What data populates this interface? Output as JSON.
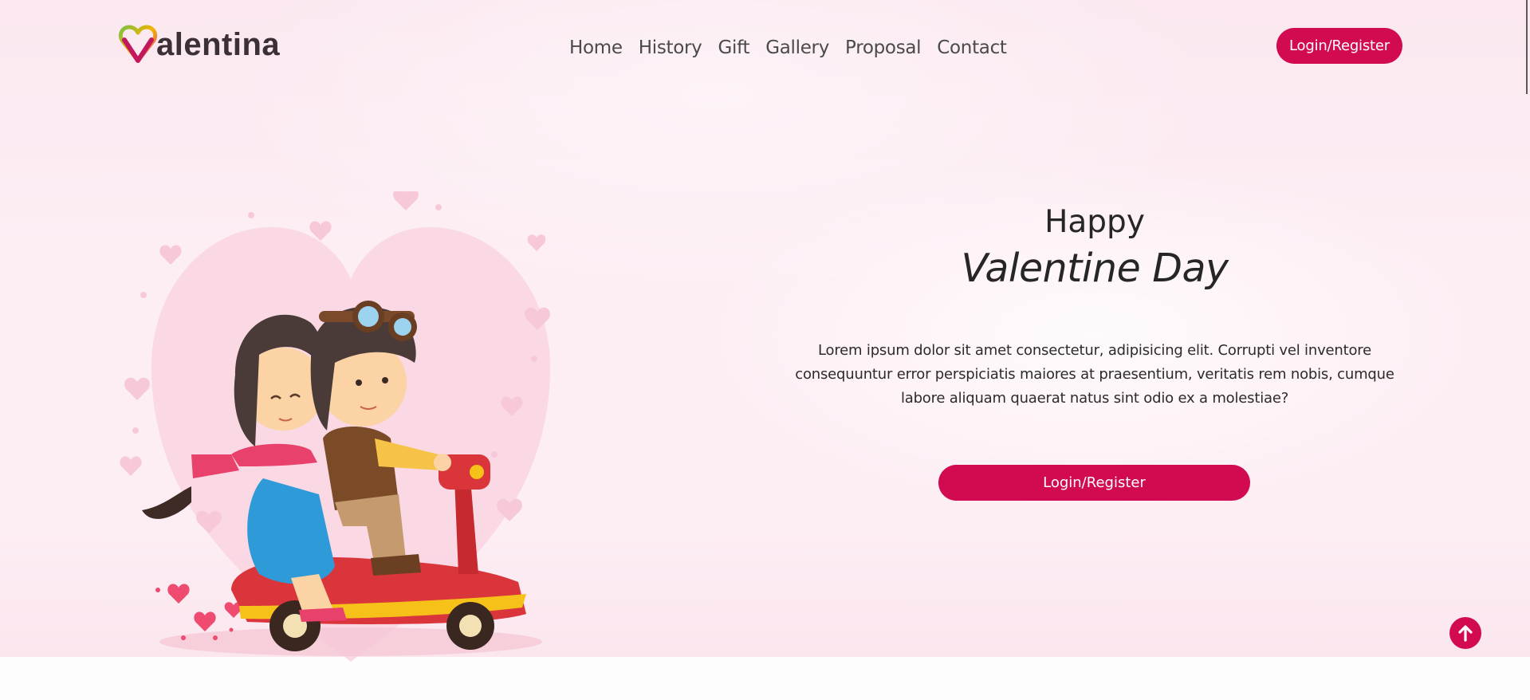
{
  "brand": {
    "logo_text": "alentina",
    "logo_initial": "V"
  },
  "nav": {
    "items": [
      {
        "label": "Home"
      },
      {
        "label": "History"
      },
      {
        "label": "Gift"
      },
      {
        "label": "Gallery"
      },
      {
        "label": "Proposal"
      },
      {
        "label": "Contact"
      }
    ]
  },
  "header": {
    "login_label": "Login/Register"
  },
  "hero": {
    "subtitle": "Happy",
    "title": "Valentine Day",
    "description": "Lorem ipsum dolor sit amet consectetur, adipisicing elit. Corrupti vel inventore consequuntur error perspiciatis maiores at praesentium, veritatis rem nobis, cumque labore aliquam quaerat natus sint odio ex a molestiae?",
    "cta_label": "Login/Register"
  },
  "icons": {
    "logo_heart": "heart-icon",
    "back_to_top": "arrow-up-icon"
  },
  "colors": {
    "accent": "#d10a52",
    "background": "#fdeef4",
    "text": "#262626"
  }
}
